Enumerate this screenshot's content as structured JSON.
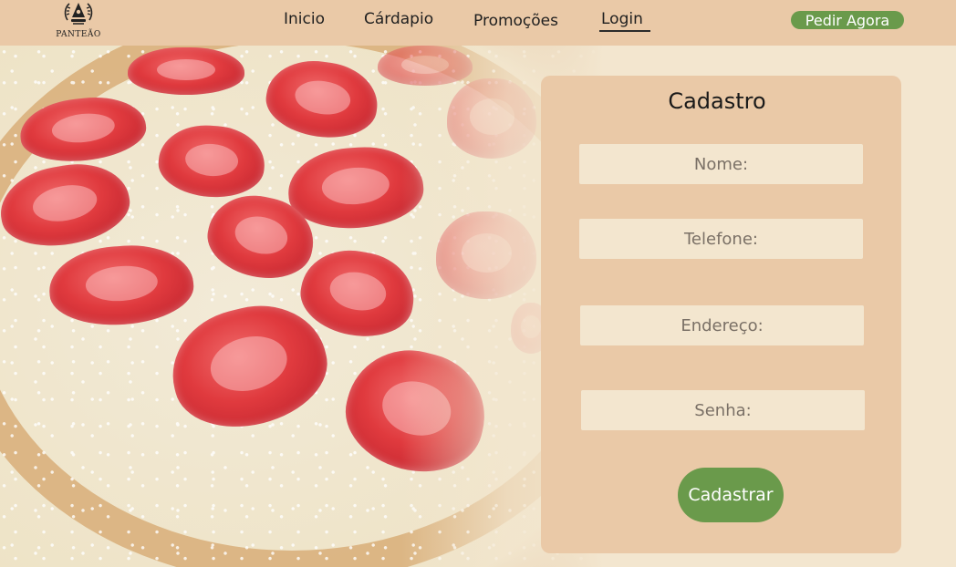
{
  "brand": {
    "name": "PANTEÃO",
    "logo_icon": "pantheon-crest-icon"
  },
  "nav": {
    "items": [
      {
        "label": "Inicio"
      },
      {
        "label": "Cárdapio"
      },
      {
        "label": "Promoções"
      },
      {
        "label": "Login",
        "active": true
      }
    ],
    "order_button": "Pedir Agora"
  },
  "hero": {
    "image": "strawberry-coconut-white-chocolate-pizza"
  },
  "form": {
    "title": "Cadastro",
    "fields": [
      {
        "placeholder": "Nome:"
      },
      {
        "placeholder": "Telefone:"
      },
      {
        "placeholder": "Endereço:"
      },
      {
        "placeholder": "Senha:"
      }
    ],
    "submit": "Cadastrar"
  },
  "colors": {
    "topbar": "#eac9a7",
    "card": "#eac9a7",
    "field": "#f3e6cf",
    "accent_green": "#6a9a4b",
    "page_bg": "#f3e6cf"
  }
}
